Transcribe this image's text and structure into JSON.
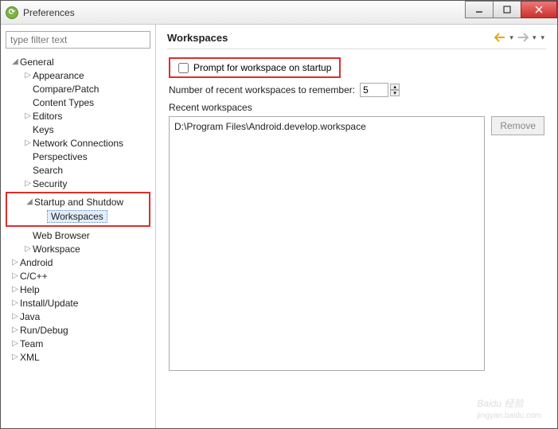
{
  "window": {
    "title": "Preferences"
  },
  "sidebar": {
    "filter_placeholder": "type filter text",
    "general": "General",
    "appearance": "Appearance",
    "compare": "Compare/Patch",
    "contentTypes": "Content Types",
    "editors": "Editors",
    "keys": "Keys",
    "network": "Network Connections",
    "perspectives": "Perspectives",
    "search": "Search",
    "security": "Security",
    "startup": "Startup and Shutdow",
    "workspaces": "Workspaces",
    "webBrowser": "Web Browser",
    "workspace": "Workspace",
    "android": "Android",
    "cpp": "C/C++",
    "help": "Help",
    "install": "Install/Update",
    "java": "Java",
    "rundebug": "Run/Debug",
    "team": "Team",
    "xml": "XML"
  },
  "page": {
    "heading": "Workspaces",
    "promptLabel": "Prompt for workspace on startup",
    "recentLabel": "Number of recent workspaces to remember:",
    "recentValue": "5",
    "listLabel": "Recent workspaces",
    "listItem0": "D:\\Program Files\\Android.develop.workspace",
    "removeLabel": "Remove"
  },
  "watermark": {
    "main": "Baidu 经验",
    "sub": "jingyan.baidu.com"
  }
}
